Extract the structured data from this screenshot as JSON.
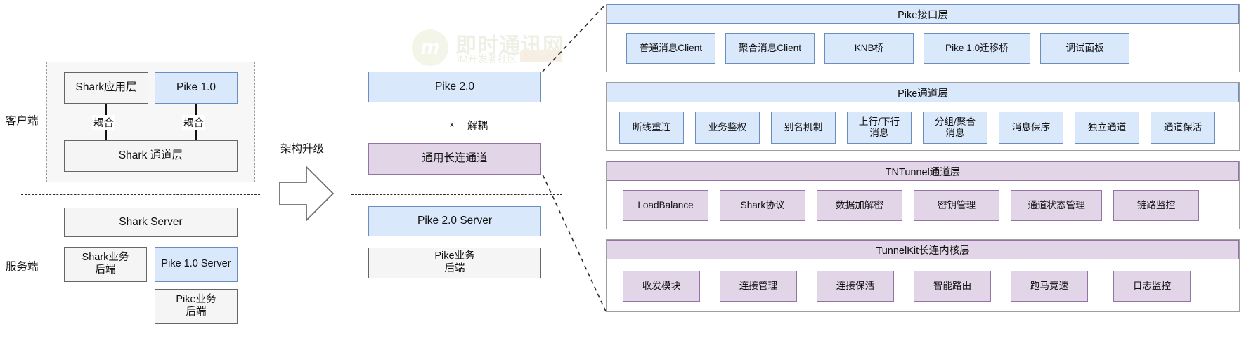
{
  "watermark": {
    "logo_letter": "m",
    "title": "即时通讯网",
    "subtitle": "IM开发者社区",
    "badge": "52im.net"
  },
  "left_diagram": {
    "side_labels": {
      "client": "客户端",
      "server": "服务端"
    },
    "client_boxes": [
      {
        "label": "Shark应用层",
        "style": "grey"
      },
      {
        "label": "Pike 1.0",
        "style": "blue"
      },
      {
        "label": "Shark 通道层",
        "style": "grey"
      }
    ],
    "couple_labels": [
      "耦合",
      "耦合"
    ],
    "server_boxes": [
      {
        "label": "Shark Server",
        "style": "grey"
      },
      {
        "label": "Shark业务\n后端",
        "style": "grey"
      },
      {
        "label": "Pike 1.0 Server",
        "style": "blue"
      },
      {
        "label": "Pike业务\n后端",
        "style": "grey"
      }
    ]
  },
  "transition": {
    "arrow_label": "架构升级"
  },
  "middle_diagram": {
    "boxes": [
      {
        "label": "Pike 2.0",
        "style": "blue"
      },
      {
        "label": "通用长连通道",
        "style": "purple"
      },
      {
        "label": "Pike 2.0 Server",
        "style": "blue"
      },
      {
        "label": "Pike业务\n后端",
        "style": "grey"
      }
    ],
    "decouple_label": "解耦",
    "decouple_mark": "×"
  },
  "right_panel": {
    "layers": [
      {
        "title": "Pike接口层",
        "style": "blue",
        "items": [
          "普通消息Client",
          "聚合消息Client",
          "KNB桥",
          "Pike 1.0迁移桥",
          "调试面板"
        ]
      },
      {
        "title": "Pike通道层",
        "style": "blue",
        "items": [
          "断线重连",
          "业务鉴权",
          "别名机制",
          "上行/下行\n消息",
          "分组/聚合\n消息",
          "消息保序",
          "独立通道",
          "通道保活"
        ]
      },
      {
        "title": "TNTunnel通道层",
        "style": "purple",
        "items": [
          "LoadBalance",
          "Shark协议",
          "数据加解密",
          "密钥管理",
          "通道状态管理",
          "链路监控"
        ]
      },
      {
        "title": "TunnelKit长连内核层",
        "style": "purple",
        "items": [
          "收发模块",
          "连接管理",
          "连接保活",
          "智能路由",
          "跑马竞速",
          "日志监控"
        ]
      }
    ]
  },
  "colors": {
    "blue_fill": "#dae8fc",
    "blue_stroke": "#6c8ebf",
    "purple_fill": "#e1d5e7",
    "purple_stroke": "#9673a6",
    "grey_fill": "#f5f5f5",
    "grey_stroke": "#666666"
  }
}
